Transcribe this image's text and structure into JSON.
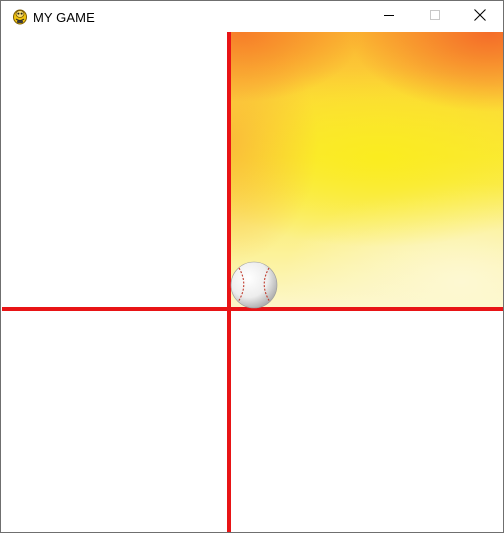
{
  "window": {
    "title": "MY GAME",
    "app_icon": "pygame-snake-icon",
    "controls": {
      "minimize_icon": "minimize-icon",
      "maximize_icon": "maximize-icon",
      "close_icon": "close-icon"
    }
  },
  "game": {
    "background_color": "#ffffff",
    "divider_color": "#e81416",
    "fire_colors": [
      "#f4681f",
      "#fbb431",
      "#fbe83a",
      "#fdf7cc"
    ],
    "sprite": "baseball"
  }
}
